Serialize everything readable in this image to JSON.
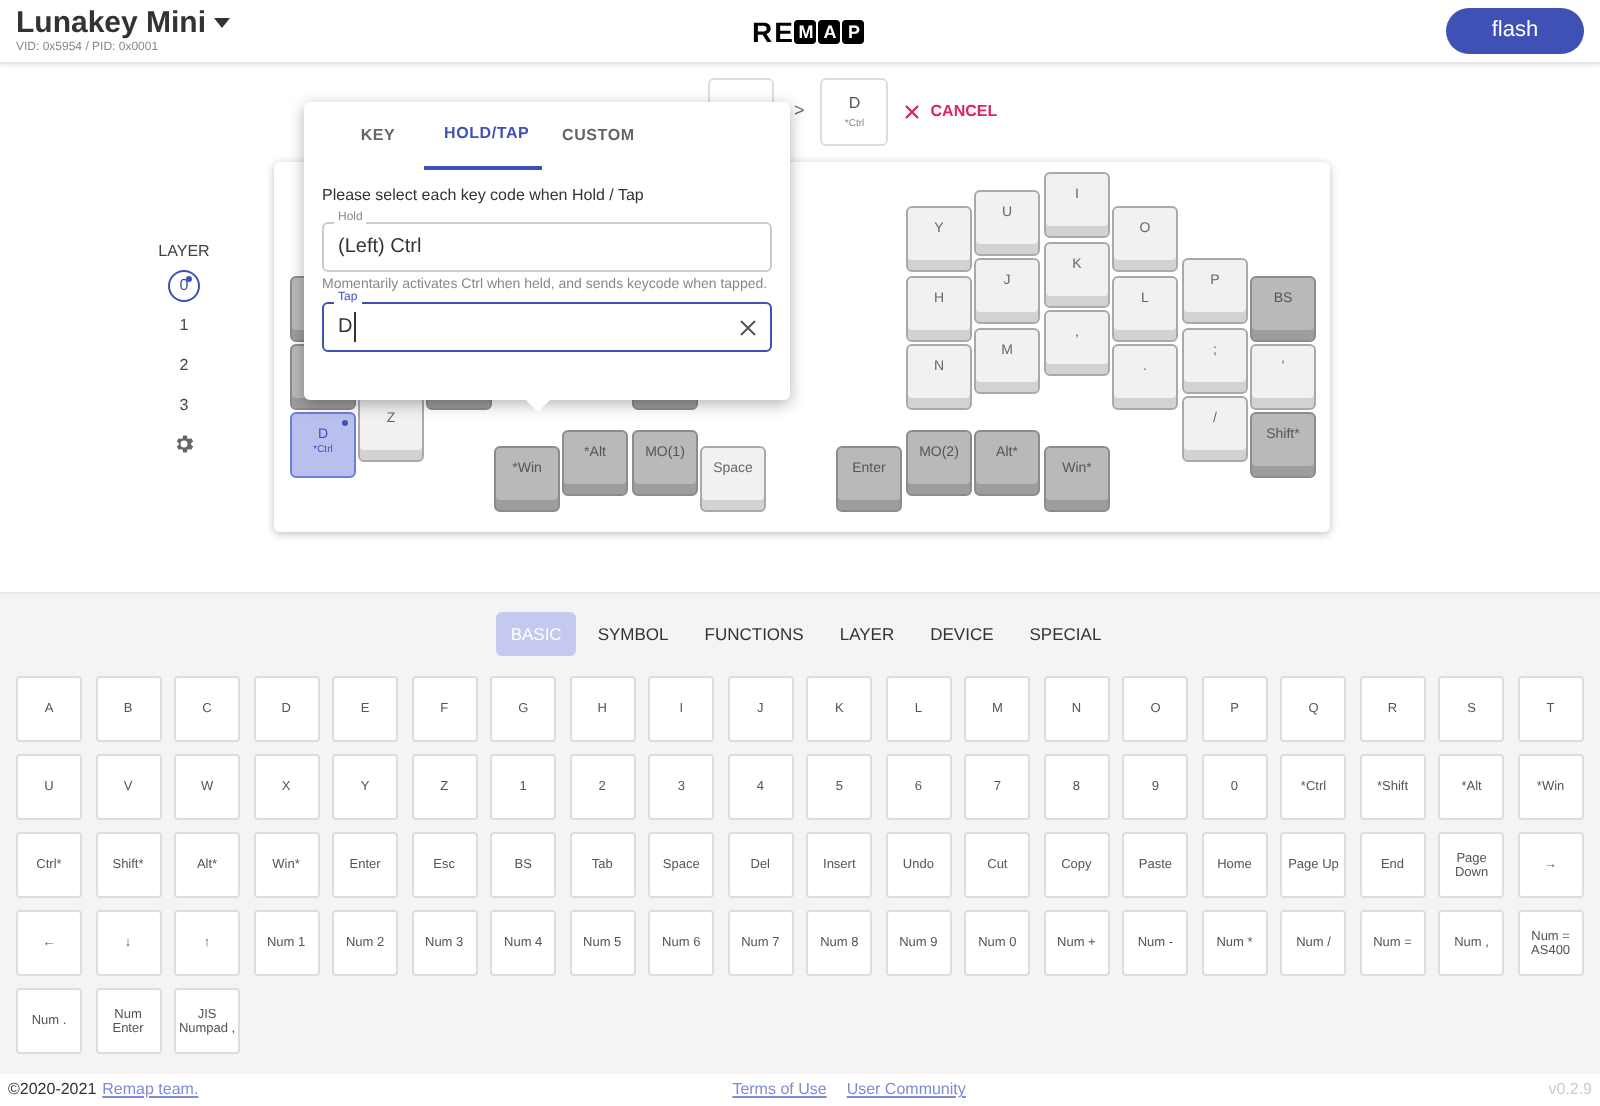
{
  "header": {
    "keyboard_name": "Lunakey Mini",
    "device_ids": "VID: 0x5954 / PID: 0x0001",
    "logo_letters": [
      "R",
      "E",
      "M",
      "A",
      "P"
    ],
    "flash_button": "flash"
  },
  "swap": {
    "arrow": ">",
    "target_label": "D",
    "target_sublabel": "*Ctrl",
    "cancel": "CANCEL"
  },
  "layers": {
    "title": "LAYER",
    "items": [
      {
        "label": "0",
        "selected": true,
        "modified": true
      },
      {
        "label": "1",
        "selected": false,
        "modified": false
      },
      {
        "label": "2",
        "selected": false,
        "modified": false
      },
      {
        "label": "3",
        "selected": false,
        "modified": false
      }
    ]
  },
  "keyboard": {
    "keys": [
      {
        "kind": "dark"
      },
      {
        "kind": "dark"
      },
      {
        "label": "D",
        "sublabel": "*Ctrl",
        "kind": "light",
        "selected": true,
        "modified": true
      },
      {
        "label": "Z",
        "kind": "light",
        "selected": false,
        "modified": false
      },
      {
        "kind": "dark"
      },
      {
        "kind": "dark"
      },
      {
        "label": "*Win",
        "kind": "dark",
        "selected": false,
        "modified": false
      },
      {
        "label": "*Alt",
        "kind": "dark",
        "selected": false,
        "modified": false
      },
      {
        "label": "MO(1)",
        "kind": "dark",
        "selected": false,
        "modified": false
      },
      {
        "label": "Space",
        "kind": "light",
        "selected": false,
        "modified": false
      },
      {
        "label": "Y",
        "kind": "light",
        "selected": false,
        "modified": false
      },
      {
        "label": "U",
        "kind": "light",
        "selected": false,
        "modified": false
      },
      {
        "label": "I",
        "kind": "light",
        "selected": false,
        "modified": false
      },
      {
        "label": "O",
        "kind": "light",
        "selected": false,
        "modified": false
      },
      {
        "label": "H",
        "kind": "light",
        "selected": false,
        "modified": false
      },
      {
        "label": "J",
        "kind": "light",
        "selected": false,
        "modified": false
      },
      {
        "label": "K",
        "kind": "light",
        "selected": false,
        "modified": false
      },
      {
        "label": "L",
        "kind": "light",
        "selected": false,
        "modified": false
      },
      {
        "label": "P",
        "kind": "light",
        "selected": false,
        "modified": false
      },
      {
        "label": "BS",
        "kind": "dark",
        "selected": false,
        "modified": false
      },
      {
        "label": "N",
        "kind": "light",
        "selected": false,
        "modified": false
      },
      {
        "label": "M",
        "kind": "light",
        "selected": false,
        "modified": false
      },
      {
        "label": ",",
        "kind": "light",
        "selected": false,
        "modified": false
      },
      {
        "label": ".",
        "kind": "light",
        "selected": false,
        "modified": false
      },
      {
        "label": ";",
        "kind": "light",
        "selected": false,
        "modified": false
      },
      {
        "label": "'",
        "kind": "light",
        "selected": false,
        "modified": false
      },
      {
        "label": "/",
        "kind": "light",
        "selected": false,
        "modified": false
      },
      {
        "label": "Shift*",
        "kind": "dark",
        "selected": false,
        "modified": false
      },
      {
        "label": "Enter",
        "kind": "dark",
        "selected": false,
        "modified": false
      },
      {
        "label": "MO(2)",
        "kind": "dark",
        "selected": false,
        "modified": false
      },
      {
        "label": "Alt*",
        "kind": "dark",
        "selected": false,
        "modified": false
      },
      {
        "label": "Win*",
        "kind": "dark",
        "selected": false,
        "modified": false
      }
    ]
  },
  "popup": {
    "tabs": [
      {
        "label": "KEY",
        "selected": false
      },
      {
        "label": "HOLD/TAP",
        "selected": true
      },
      {
        "label": "CUSTOM",
        "selected": false
      }
    ],
    "instruction": "Please select each key code when Hold / Tap",
    "hold": {
      "label": "Hold",
      "value": "(Left) Ctrl"
    },
    "hold_help": "Momentarily activates Ctrl when held, and sends keycode when tapped.",
    "tap": {
      "label": "Tap",
      "value": "D"
    }
  },
  "palette": {
    "tabs": [
      {
        "label": "BASIC",
        "selected": true
      },
      {
        "label": "SYMBOL",
        "selected": false
      },
      {
        "label": "FUNCTIONS",
        "selected": false
      },
      {
        "label": "LAYER",
        "selected": false
      },
      {
        "label": "DEVICE",
        "selected": false
      },
      {
        "label": "SPECIAL",
        "selected": false
      }
    ],
    "keys": [
      "A",
      "B",
      "C",
      "D",
      "E",
      "F",
      "G",
      "H",
      "I",
      "J",
      "K",
      "L",
      "M",
      "N",
      "O",
      "P",
      "Q",
      "R",
      "S",
      "T",
      "U",
      "V",
      "W",
      "X",
      "Y",
      "Z",
      "1",
      "2",
      "3",
      "4",
      "5",
      "6",
      "7",
      "8",
      "9",
      "0",
      "*Ctrl",
      "*Shift",
      "*Alt",
      "*Win",
      "Ctrl*",
      "Shift*",
      "Alt*",
      "Win*",
      "Enter",
      "Esc",
      "BS",
      "Tab",
      "Space",
      "Del",
      "Insert",
      "Undo",
      "Cut",
      "Copy",
      "Paste",
      "Home",
      "Page Up",
      "End",
      "Page Down",
      "→",
      "←",
      "↓",
      "↑",
      "Num 1",
      "Num 2",
      "Num 3",
      "Num 4",
      "Num 5",
      "Num 6",
      "Num 7",
      "Num 8",
      "Num 9",
      "Num 0",
      "Num +",
      "Num -",
      "Num *",
      "Num /",
      "Num =",
      "Num ,",
      "Num = AS400",
      "Num .",
      "Num Enter",
      "JIS Numpad ,"
    ]
  },
  "footer": {
    "copyright": "©2020-2021",
    "team_link": "Remap team.",
    "links": [
      "Terms of Use",
      "User Community"
    ],
    "version": "v0.2.9"
  }
}
